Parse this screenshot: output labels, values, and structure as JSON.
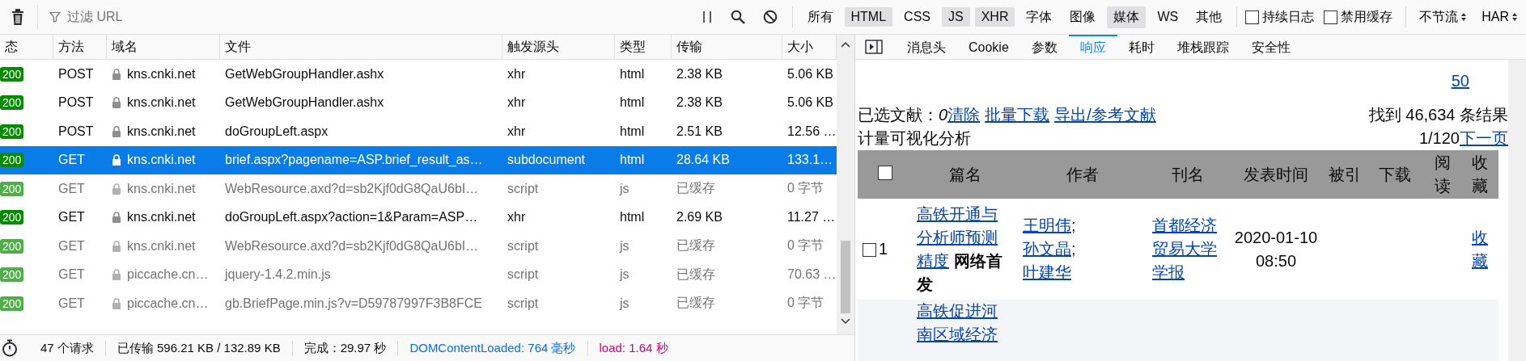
{
  "toolbar": {
    "filter": {
      "placeholder": "过滤 URL"
    },
    "type_filters": [
      {
        "label": "所有",
        "selected": false
      },
      {
        "label": "HTML",
        "selected": true
      },
      {
        "label": "CSS",
        "selected": false
      },
      {
        "label": "JS",
        "selected": true
      },
      {
        "label": "XHR",
        "selected": true
      },
      {
        "label": "字体",
        "selected": false
      },
      {
        "label": "图像",
        "selected": false
      },
      {
        "label": "媒体",
        "selected": true
      },
      {
        "label": "WS",
        "selected": false
      },
      {
        "label": "其他",
        "selected": false
      }
    ],
    "options": [
      {
        "label": "持续日志",
        "checked": false
      },
      {
        "label": "禁用缓存",
        "checked": false
      }
    ],
    "throttle": "不节流",
    "har": "HAR"
  },
  "requests": {
    "columns": [
      "态",
      "方法",
      "域名",
      "文件",
      "触发源头",
      "类型",
      "传输",
      "大小"
    ],
    "rows": [
      {
        "status": "200",
        "method": "POST",
        "domain": "kns.cnki.net",
        "file": "GetWebGroupHandler.ashx",
        "initiator": "xhr",
        "type": "html",
        "transferred": "2.38 KB",
        "size": "5.06 KB",
        "cached": false,
        "selected": false
      },
      {
        "status": "200",
        "method": "POST",
        "domain": "kns.cnki.net",
        "file": "GetWebGroupHandler.ashx",
        "initiator": "xhr",
        "type": "html",
        "transferred": "2.38 KB",
        "size": "5.06 KB",
        "cached": false,
        "selected": false
      },
      {
        "status": "200",
        "method": "POST",
        "domain": "kns.cnki.net",
        "file": "doGroupLeft.aspx",
        "initiator": "xhr",
        "type": "html",
        "transferred": "2.51 KB",
        "size": "12.56 …",
        "cached": false,
        "selected": false
      },
      {
        "status": "200",
        "method": "GET",
        "domain": "kns.cnki.net",
        "file": "brief.aspx?pagename=ASP.brief_result_as…",
        "initiator": "subdocument",
        "type": "html",
        "transferred": "28.64 KB",
        "size": "133.1…",
        "cached": false,
        "selected": true
      },
      {
        "status": "200",
        "method": "GET",
        "domain": "kns.cnki.net",
        "file": "WebResource.axd?d=sb2Kjf0dG8QaU6bI…",
        "initiator": "script",
        "type": "js",
        "transferred": "已缓存",
        "size": "0 字节",
        "cached": true,
        "selected": false
      },
      {
        "status": "200",
        "method": "GET",
        "domain": "kns.cnki.net",
        "file": "doGroupLeft.aspx?action=1&Param=ASP…",
        "initiator": "xhr",
        "type": "html",
        "transferred": "2.69 KB",
        "size": "11.27 …",
        "cached": false,
        "selected": false
      },
      {
        "status": "200",
        "method": "GET",
        "domain": "kns.cnki.net",
        "file": "WebResource.axd?d=sb2Kjf0dG8QaU6bI…",
        "initiator": "script",
        "type": "js",
        "transferred": "已缓存",
        "size": "0 字节",
        "cached": true,
        "selected": false
      },
      {
        "status": "200",
        "method": "GET",
        "domain": "piccache.cn…",
        "file": "jquery-1.4.2.min.js",
        "initiator": "script",
        "type": "js",
        "transferred": "已缓存",
        "size": "70.63 …",
        "cached": true,
        "selected": false
      },
      {
        "status": "200",
        "method": "GET",
        "domain": "piccache.cn…",
        "file": "gb.BriefPage.min.js?v=D59787997F3B8FCE",
        "initiator": "script",
        "type": "js",
        "transferred": "已缓存",
        "size": "0 字节",
        "cached": true,
        "selected": false
      }
    ]
  },
  "status_bar": {
    "requests": "47 个请求",
    "transferred": "已传输 596.21 KB / 132.89 KB",
    "finish": "完成：29.97 秒",
    "dom_content_loaded": "DOMContentLoaded: 764 毫秒",
    "load": "load: 1.64 秒"
  },
  "details": {
    "tabs": [
      {
        "label": "消息头",
        "selected": false
      },
      {
        "label": "Cookie",
        "selected": false
      },
      {
        "label": "参数",
        "selected": false
      },
      {
        "label": "响应",
        "selected": true
      },
      {
        "label": "耗时",
        "selected": false
      },
      {
        "label": "堆栈跟踪",
        "selected": false
      },
      {
        "label": "安全性",
        "selected": false
      }
    ],
    "response": {
      "page_size_link": "50",
      "selected_label": "已选文献：",
      "selected_count": "0",
      "actions": [
        "清除",
        "批量下载",
        "导出/参考文献"
      ],
      "found": "找到 46,634 条结果",
      "visualize": "计量可视化分析",
      "page": "1/120",
      "next": "下一页",
      "table": {
        "select_all_checked": false,
        "columns": [
          "篇名",
          "作者",
          "刊名",
          "发表时间",
          "被引",
          "下载",
          "阅读",
          "收藏"
        ],
        "rows": [
          {
            "index": "1",
            "checked": false,
            "title": "高铁开通与分析师预测精度",
            "badge": "网络首发",
            "authors": [
              {
                "name": "王明伟",
                "separator": ";"
              },
              {
                "name": "孙文晶",
                "separator": ";"
              },
              {
                "name": "叶建华"
              }
            ],
            "journal": "首都经济贸易大学学报",
            "date": "2020-01-10 08:50",
            "favorite": "收藏"
          },
          {
            "title": "高铁促进河南区域经济"
          }
        ]
      }
    }
  }
}
